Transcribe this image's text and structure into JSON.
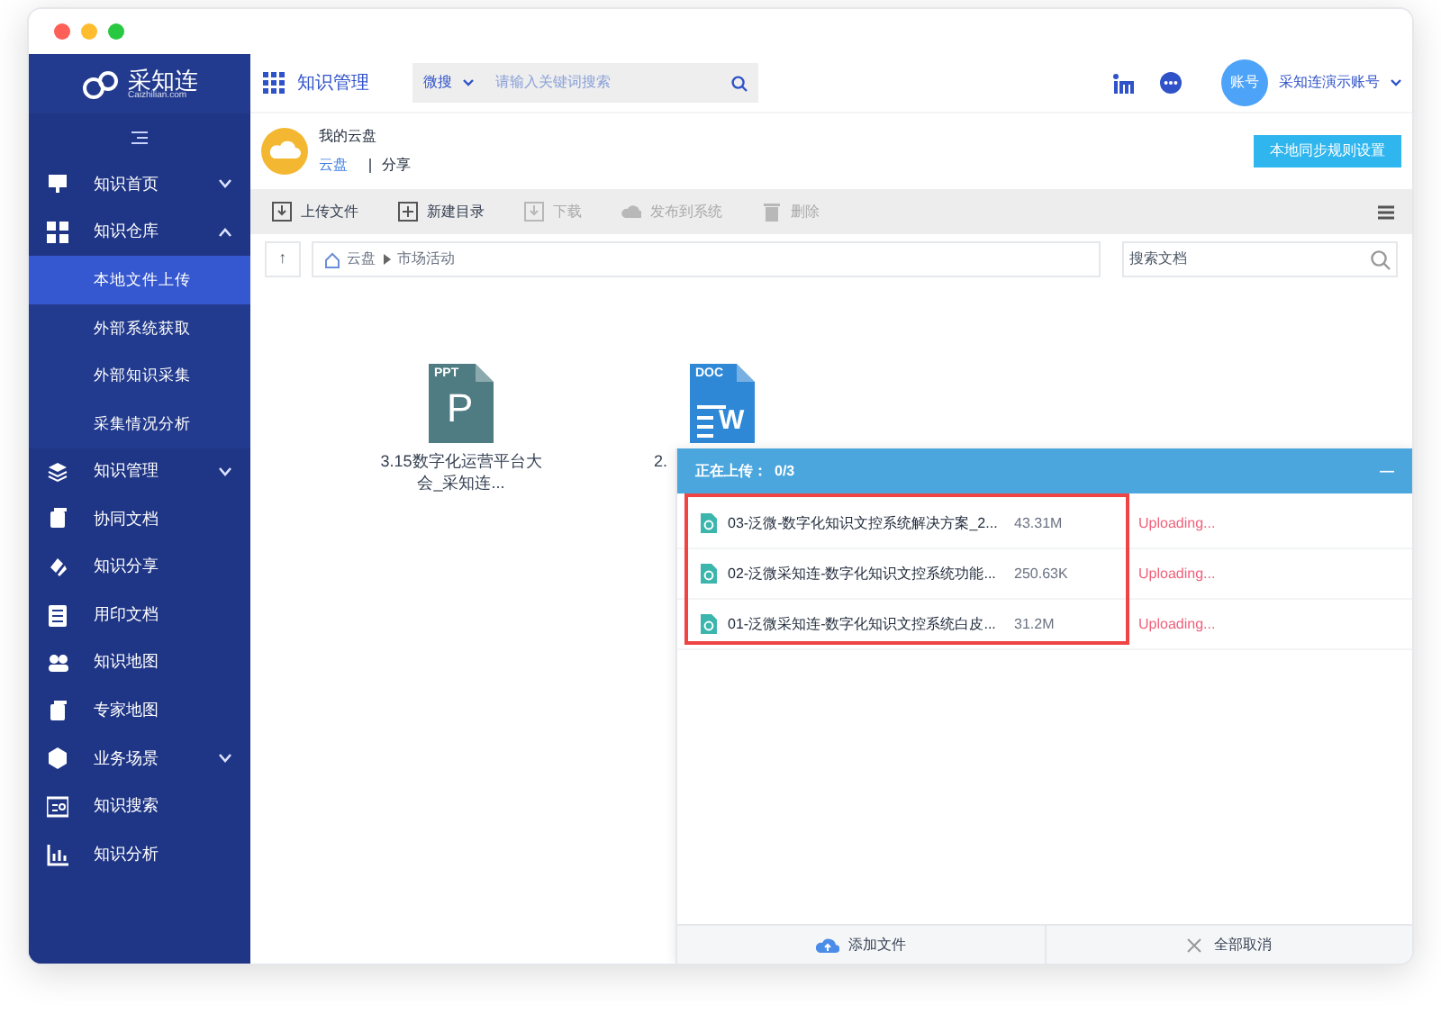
{
  "logo": {
    "name": "采知连",
    "sub": "Caizhilian.com"
  },
  "sidebar": {
    "items": [
      {
        "label": "知识首页",
        "expanded": false
      },
      {
        "label": "知识仓库",
        "expanded": true,
        "children": [
          {
            "label": "本地文件上传",
            "selected": true
          },
          {
            "label": "外部系统获取",
            "selected": false
          },
          {
            "label": "外部知识采集",
            "selected": false
          },
          {
            "label": "采集情况分析",
            "selected": false
          }
        ]
      },
      {
        "label": "知识管理",
        "expanded": false
      },
      {
        "label": "协同文档"
      },
      {
        "label": "知识分享"
      },
      {
        "label": "用印文档"
      },
      {
        "label": "知识地图"
      },
      {
        "label": "专家地图"
      },
      {
        "label": "业务场景",
        "expanded": false
      },
      {
        "label": "知识搜索"
      },
      {
        "label": "知识分析"
      }
    ]
  },
  "header": {
    "title": "知识管理",
    "search_scope": "微搜",
    "search": {
      "placeholder": "请输入关键词搜索"
    },
    "avatar": "账号",
    "account": "采知连演示账号"
  },
  "cloud": {
    "title": "我的云盘",
    "tabs": [
      {
        "label": "云盘",
        "selected": true
      },
      {
        "label": "分享",
        "selected": false
      }
    ],
    "sync_button": "本地同步规则设置"
  },
  "toolbar": [
    {
      "label": "上传文件",
      "disabled": false
    },
    {
      "label": "新建目录",
      "disabled": false
    },
    {
      "label": "下载",
      "disabled": true
    },
    {
      "label": "发布到系统",
      "disabled": true
    },
    {
      "label": "删除",
      "disabled": true
    }
  ],
  "path": {
    "up": "↑",
    "crumbs": [
      "云盘",
      "市场活动"
    ],
    "search": {
      "placeholder": "搜索文档"
    }
  },
  "files": [
    {
      "kind": "ppt",
      "badge": "PPT",
      "letter": "P",
      "name": "3.15数字化运营平台大会_采知连..."
    },
    {
      "kind": "doc",
      "badge": "DOC",
      "letter": "W",
      "name": "2."
    }
  ],
  "upload_panel": {
    "title": "正在上传：",
    "count": "0/3",
    "collapse": "—",
    "rows": [
      {
        "name": "03-泛微-数字化知识文控系统解决方案_2...",
        "size": "43.31M",
        "status": "Uploading..."
      },
      {
        "name": "02-泛微采知连-数字化知识文控系统功能...",
        "size": "250.63K",
        "status": "Uploading..."
      },
      {
        "name": "01-泛微采知连-数字化知识文控系统白皮...",
        "size": "31.2M",
        "status": "Uploading..."
      }
    ],
    "add_button": "添加文件",
    "cancel_button": "全部取消"
  }
}
